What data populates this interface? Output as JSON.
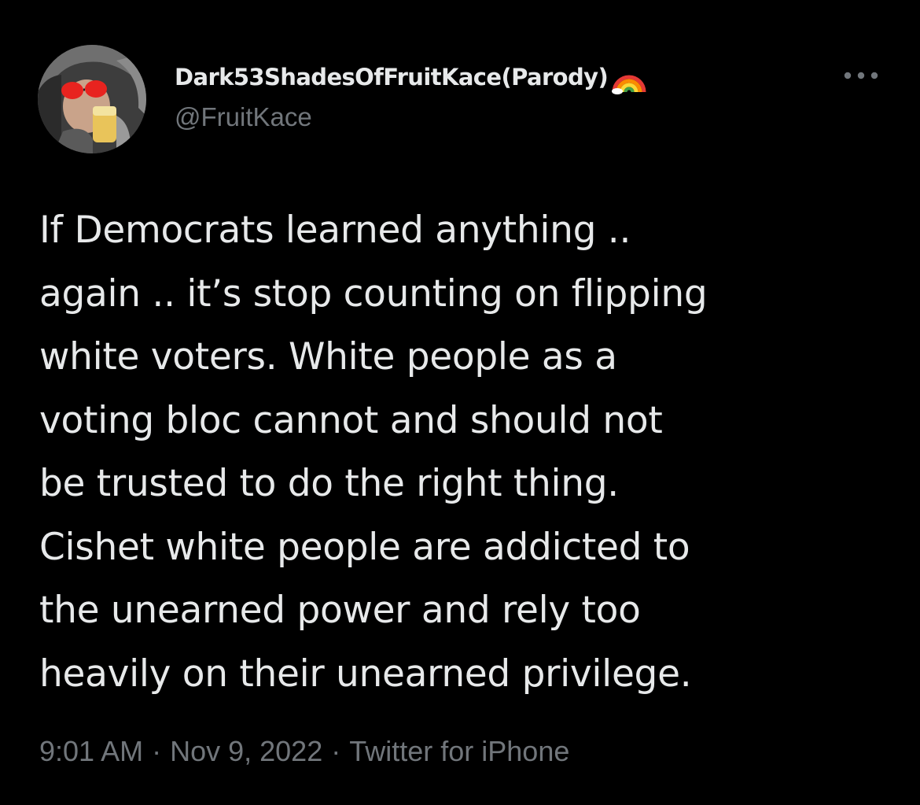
{
  "tweet": {
    "author": {
      "display_name": "Dark53ShadesOfFruitKace(Parody)",
      "badge_icon": "rainbow-emoji",
      "handle": "@FruitKace"
    },
    "more_icon": "ellipsis-icon",
    "body_lines": [
      "If Democrats learned anything  ..",
      "again .. it’s stop counting on flipping",
      "white voters. White people as a",
      "voting bloc cannot and should not",
      "be trusted to do the right thing.",
      "Cishet white people are addicted to",
      "the unearned power and rely too",
      "heavily on their unearned privilege."
    ],
    "meta": {
      "time": "9:01 AM",
      "separator": "·",
      "date": "Nov 9, 2022",
      "source": "Twitter for iPhone"
    }
  },
  "colors": {
    "background": "#000000",
    "primary_text": "#e7e9ea",
    "secondary_text": "#71767b"
  }
}
